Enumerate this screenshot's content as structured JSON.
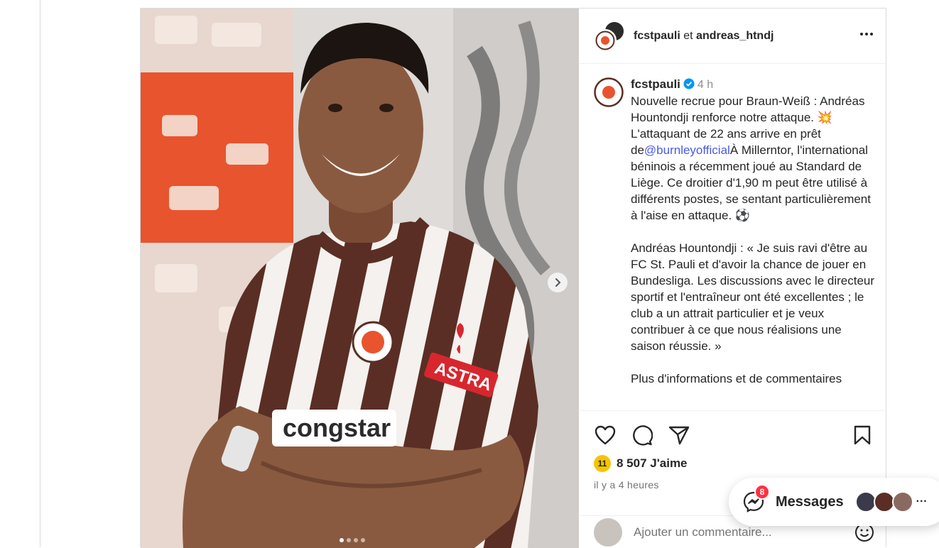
{
  "post": {
    "header": {
      "author": "fcstpauli",
      "connector": "et",
      "collaborator": "andreas_htndj",
      "more_icon": "more-horizontal-icon"
    },
    "caption": {
      "username": "fcstpauli",
      "verified": true,
      "time": "4 h",
      "text_before_mention": "Nouvelle recrue pour Braun-Weiß : Andréas Hountondji renforce notre attaque. 💥 L'attaquant de 22 ans arrive en prêt de",
      "mention": "@burnleyofficial",
      "text_after_mention": "À Millerntor, l'international béninois a récemment joué au Standard de Liège. Ce droitier d'1,90 m peut être utilisé à différents postes, se sentant particulièrement à l'aise en attaque. ⚽",
      "paragraph2": "Andréas Hountondji : « Je suis ravi d'être au FC St. Pauli et d'avoir la chance de jouer en Bundesliga. Les discussions avec le directeur sportif et l'entraîneur ont été excellentes ; le club a un attrait particulier et je veux contribuer à ce que nous réalisions une saison réussie. »",
      "paragraph3_partial": "Plus d'informations et de commentaires"
    },
    "actions": {
      "like_icon": "heart-icon",
      "comment_icon": "comment-icon",
      "share_icon": "send-icon",
      "save_icon": "bookmark-icon"
    },
    "likes": {
      "count_label": "8 507 J'aime",
      "liker_badge": "11"
    },
    "time_ago": "il y a 4 heures",
    "comment": {
      "placeholder": "Ajouter un commentaire...",
      "emoji_icon": "emoji-icon"
    },
    "media": {
      "jersey_sponsor": "congstar",
      "sleeve_sponsor": "ASTRA",
      "crest_text": "FC ST. PAULI",
      "crest_year": "1910",
      "carousel_dots": 4,
      "active_dot": 0
    }
  },
  "messages": {
    "label": "Messages",
    "badge": "8",
    "more": "···"
  },
  "colors": {
    "brown": "#5a2e25",
    "accent_link": "#4a5ae8",
    "badge_red": "#ff3040",
    "verified_blue": "#0095f6"
  }
}
